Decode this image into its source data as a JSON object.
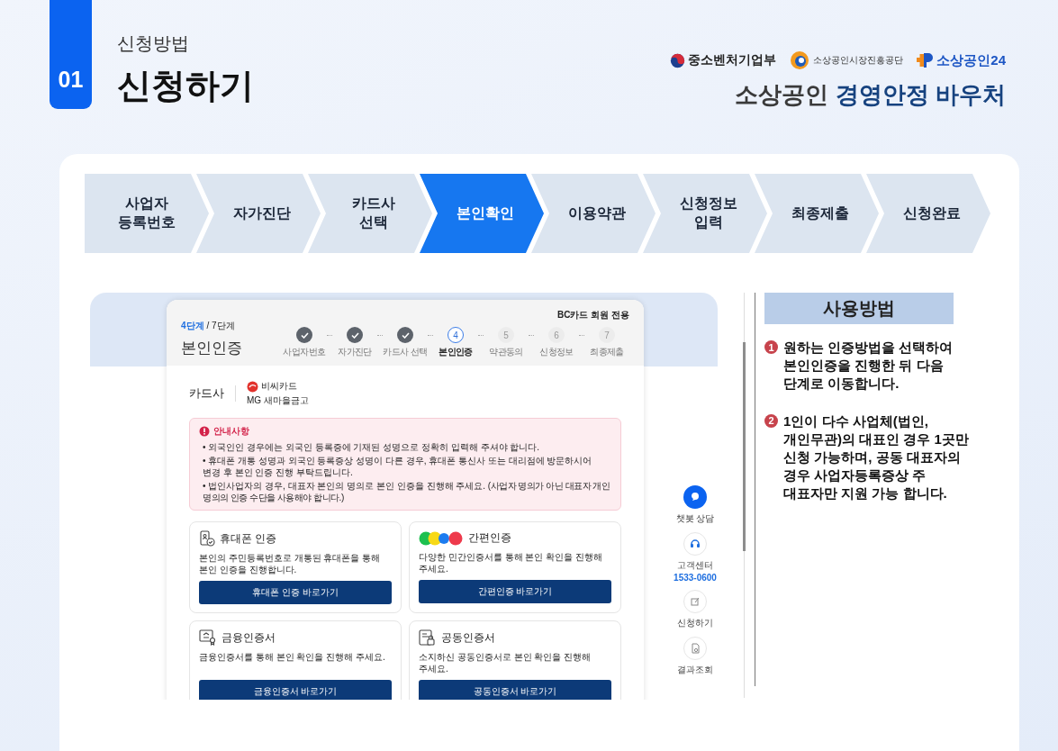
{
  "header": {
    "section_number": "01",
    "subtitle": "신청방법",
    "title": "신청하기"
  },
  "logos": [
    {
      "kind": "ministry",
      "label": "중소벤처기업부"
    },
    {
      "kind": "agency",
      "label": "소상공인시장진흥공단"
    },
    {
      "kind": "portal",
      "label": "소상공인24"
    }
  ],
  "brand": {
    "prefix": "소상공인",
    "highlight": "경영안정 바우처"
  },
  "steps": [
    {
      "label": "사업자\n등록번호",
      "selected": false
    },
    {
      "label": "자가진단",
      "selected": false
    },
    {
      "label": "카드사\n선택",
      "selected": false
    },
    {
      "label": "본인확인",
      "selected": true
    },
    {
      "label": "이용약관",
      "selected": false
    },
    {
      "label": "신청정보\n입력",
      "selected": false
    },
    {
      "label": "최종제출",
      "selected": false
    },
    {
      "label": "신청완료",
      "selected": false
    }
  ],
  "preview": {
    "step_current": "4단계",
    "step_total": "/ 7단계",
    "page_title": "본인인증",
    "member_note": "BC카드 회원 전용",
    "progress": [
      {
        "label": "사업자번호",
        "done": true,
        "current": false
      },
      {
        "label": "자가진단",
        "done": true,
        "current": false
      },
      {
        "label": "카드사 선택",
        "done": true,
        "current": false
      },
      {
        "label": "본인인증",
        "number": "4",
        "done": false,
        "current": true
      },
      {
        "label": "약관동의",
        "number": "5",
        "done": false,
        "current": false
      },
      {
        "label": "신청정보",
        "number": "6",
        "done": false,
        "current": false
      },
      {
        "label": "최종제출",
        "number": "7",
        "done": false,
        "current": false
      }
    ],
    "card_company": {
      "label": "카드사",
      "name": "비씨카드",
      "issuer": "MG 새마을금고"
    },
    "notice": {
      "title": "안내사항",
      "items": [
        {
          "text": "• 외국인인 경우에는 외국인 등록증에 기재된 성명으로 정확히 입력해 주셔야 합니다."
        },
        {
          "text": "• 휴대폰 개통 성명과 외국인 등록증상 성명이 다른 경우, 휴대폰 통신사 또는 대리점에 방문하시어 변경 후 본인 인증 진행 부탁드립니다."
        },
        {
          "text": "• 법인사업자의 경우, 대표자 본인의 명의로 본인 인증을 진행해 주세요.",
          "note": "(사업자 명의가 아닌 대표자 개인 명의의 인증 수단을 사용해야 합니다.)"
        }
      ]
    },
    "methods": [
      {
        "kind": "phone",
        "title": "휴대폰 인증",
        "description": "본인의 주민등록번호로 개통된 휴대폰을 통해 본인 인증을 진행합니다.",
        "button": "휴대폰 인증 바로가기"
      },
      {
        "kind": "easy",
        "title": "간편인증",
        "description": "다양한 민간인증서를 통해 본인 확인을 진행해 주세요.",
        "button": "간편인증 바로가기"
      },
      {
        "kind": "financial",
        "title": "금융인증서",
        "description": "금융인증서를 통해 본인 확인을 진행해 주세요.",
        "button": "금융인증서 바로가기"
      },
      {
        "kind": "joint",
        "title": "공동인증서",
        "description": "소지하신 공동인증서로 본인 확인을 진행해 주세요.",
        "button": "공동인증서 바로가기"
      }
    ]
  },
  "quick_menu": [
    {
      "kind": "chat",
      "label": "챗봇 상담"
    },
    {
      "kind": "call",
      "label": "고객센터",
      "phone": "1533-0600"
    },
    {
      "kind": "apply",
      "label": "신청하기"
    },
    {
      "kind": "result",
      "label": "결과조회"
    }
  ],
  "usage": {
    "title": "사용방법",
    "items": [
      {
        "number": "1",
        "text": "원하는 인증방법을 선택하여\n본인인증을 진행한 뒤 다음\n단계로 이동합니다."
      },
      {
        "number": "2",
        "text": "1인이 다수 사업체(법인,\n개인무관)의 대표인 경우 1곳만\n신청 가능하며, 공동 대표자의\n경우 사업자등록증상 주\n대표자만 지원 가능 합니다."
      }
    ]
  }
}
